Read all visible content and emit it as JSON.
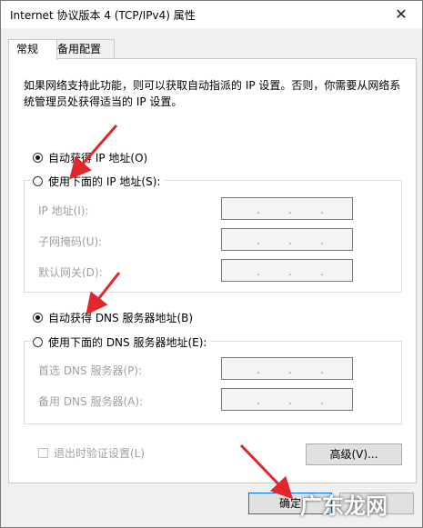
{
  "window": {
    "title": "Internet 协议版本 4 (TCP/IPv4) 属性",
    "close_glyph": "✕"
  },
  "tabs": [
    {
      "label": "常规"
    },
    {
      "label": "备用配置"
    }
  ],
  "description": "如果网络支持此功能，则可以获取自动指派的 IP 设置。否则，你需要从网络系统管理员处获得适当的 IP 设置。",
  "ip_section": {
    "auto_label": "自动获得 IP 地址(O)",
    "manual_label": "使用下面的 IP 地址(S):",
    "fields": [
      {
        "label": "IP 地址(I):",
        "value": ". . ."
      },
      {
        "label": "子网掩码(U):",
        "value": ". . ."
      },
      {
        "label": "默认网关(D):",
        "value": ". . ."
      }
    ]
  },
  "dns_section": {
    "auto_label": "自动获得 DNS 服务器地址(B)",
    "manual_label": "使用下面的 DNS 服务器地址(E):",
    "fields": [
      {
        "label": "首选 DNS 服务器(P):",
        "value": ". . ."
      },
      {
        "label": "备用 DNS 服务器(A):",
        "value": ". . ."
      }
    ]
  },
  "validate_label": "退出时验证设置(L)",
  "advanced_label": "高级(V)...",
  "ok_label": "确定",
  "watermark": "广东龙网",
  "colors": {
    "arrow": "#e3262b",
    "accent": "#0078d7"
  }
}
